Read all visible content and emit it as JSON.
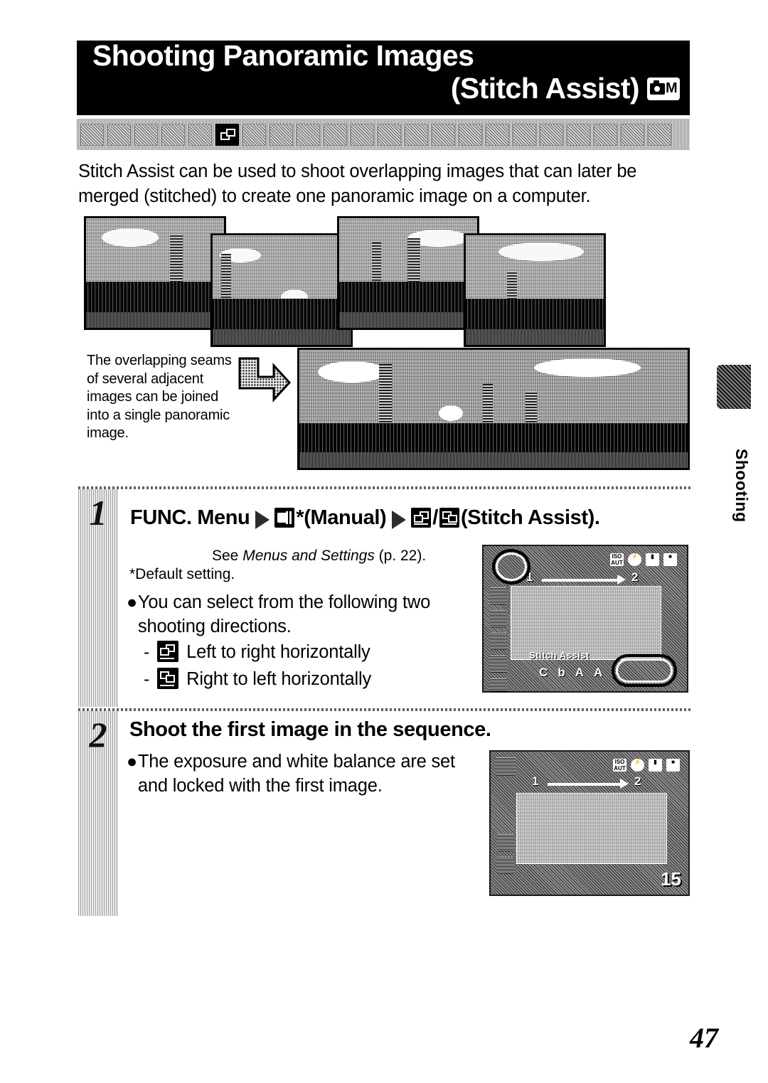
{
  "page": {
    "number": "47",
    "side_tab_label": "Shooting"
  },
  "title": {
    "line1": "Shooting Panoramic Images",
    "line2": "(Stitch Assist)",
    "badge_letter": "M",
    "badge_icon": "camera-icon"
  },
  "mode_strip": {
    "count": 22,
    "active_index": 5,
    "active_icon": "stitch-assist-mode-icon"
  },
  "intro": "Stitch Assist can be used to shoot overlapping images that can later be merged (stitched) to create one panoramic image on a computer.",
  "collage": {
    "caption": "The overlapping seams of several adjacent images can be joined into a single panoramic image.",
    "arrow_icon": "bent-arrow-icon",
    "photo_count": 4,
    "panorama_alt": "merged panoramic cityscape"
  },
  "steps": [
    {
      "number": "1",
      "heading_parts": [
        {
          "type": "text",
          "value": "FUNC. Menu"
        },
        {
          "type": "arrow"
        },
        {
          "type": "icon",
          "value": "manual-mode-icon"
        },
        {
          "type": "text",
          "value": "*(Manual)"
        },
        {
          "type": "arrow"
        },
        {
          "type": "icon",
          "value": "stitch-left-to-right-icon"
        },
        {
          "type": "text",
          "value": "/"
        },
        {
          "type": "icon",
          "value": "stitch-right-to-left-icon"
        },
        {
          "type": "text",
          "value": "(Stitch Assist)."
        }
      ],
      "see_prefix": "See ",
      "see_italic": "Menus and Settings",
      "see_suffix": " (p. 22).",
      "default_note": "*Default setting.",
      "bullet": "You can select from the following two shooting directions.",
      "options": [
        {
          "icon": "stitch-left-to-right-icon",
          "label": "Left to right horizontally"
        },
        {
          "icon": "stitch-right-to-left-icon",
          "label": "Right to left horizontally"
        }
      ]
    },
    {
      "number": "2",
      "heading": "Shoot the first image in the sequence.",
      "bullet": "The exposure and white balance are set and locked with the first image."
    }
  ],
  "lcd_screen_1": {
    "indicator_start": "1",
    "indicator_end": "2",
    "caption": "Stitch Assist",
    "top_icons": [
      "iso-auto-icon",
      "flash-icon",
      "display-icon",
      "battery-icon"
    ],
    "bottom_icons": [
      "C",
      "b",
      "A",
      "A"
    ],
    "callouts": [
      "func-menu-callout",
      "stitch-direction-callout"
    ]
  },
  "lcd_screen_2": {
    "indicator_start": "1",
    "indicator_end": "2",
    "frame_counter": "15",
    "top_icons": [
      "iso-auto-icon",
      "flash-icon",
      "display-icon",
      "battery-icon"
    ]
  }
}
